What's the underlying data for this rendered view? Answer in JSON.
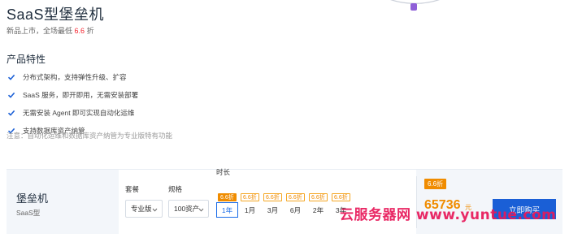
{
  "header": {
    "title": "SaaS型堡垒机",
    "subtitle_prefix": "新品上市，全场最低",
    "subtitle_discount": "6.6",
    "subtitle_suffix": "折"
  },
  "features": {
    "heading": "产品特性",
    "items": [
      {
        "text": "分布式架构，支持弹性升级、扩容",
        "icon": "check-icon"
      },
      {
        "text": "SaaS 服务，即开即用，无需安装部署",
        "icon": "check-icon"
      },
      {
        "text": "无需安装 Agent 即可实现自动化运维",
        "icon": "check-icon"
      },
      {
        "text": "支持数据库资产纳管",
        "icon": "check-icon"
      }
    ],
    "note": "注意：自动化运维和数据库资产纳管为专业版特有功能"
  },
  "purchase": {
    "product_name": "堡垒机",
    "product_type": "SaaS型",
    "package_label": "套餐",
    "package_value": "专业版",
    "spec_label": "规格",
    "spec_value": "100资产",
    "duration_label": "时长",
    "durations": [
      {
        "badge": "6.6折",
        "label": "1年",
        "selected": true
      },
      {
        "badge": "6.6折",
        "label": "1月",
        "selected": false
      },
      {
        "badge": "6.6折",
        "label": "3月",
        "selected": false
      },
      {
        "badge": "6.6折",
        "label": "6月",
        "selected": false
      },
      {
        "badge": "6.6折",
        "label": "2年",
        "selected": false
      },
      {
        "badge": "6.6折",
        "label": "3年",
        "selected": false
      }
    ],
    "price_badge": "6.6折",
    "price": "65736",
    "price_unit": "元",
    "buy_label": "立即购买"
  },
  "watermark": "云服务器网 www.yuntue.com",
  "colors": {
    "accent_blue": "#1a5fd6",
    "discount_orange": "#f08c00",
    "highlight_red": "#f5222d",
    "panel_bg": "#f3f6fa",
    "watermark": "#e8195a"
  }
}
